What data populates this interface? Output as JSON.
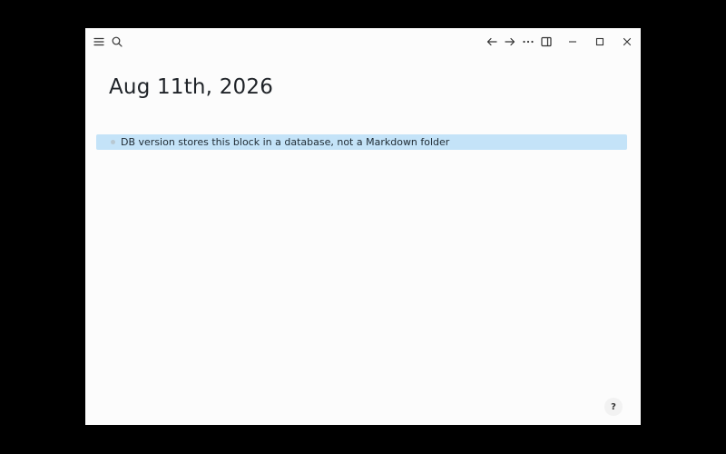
{
  "window": {
    "background": "#fcfcfc"
  },
  "toolbar": {
    "left_icons": [
      "menu-icon",
      "search-icon"
    ],
    "right_icons": [
      "arrow-left-icon",
      "arrow-right-icon",
      "more-icon",
      "sidebar-toggle-icon",
      "minimize-icon",
      "maximize-icon",
      "close-icon"
    ]
  },
  "page": {
    "title": "Aug 11th, 2026",
    "blocks": [
      {
        "text": "DB version stores this block in a database, not a Markdown folder",
        "selected": true
      }
    ]
  },
  "help": {
    "label": "?"
  },
  "colors": {
    "selection": "#c4e3f8",
    "title_text": "#1f2328"
  }
}
